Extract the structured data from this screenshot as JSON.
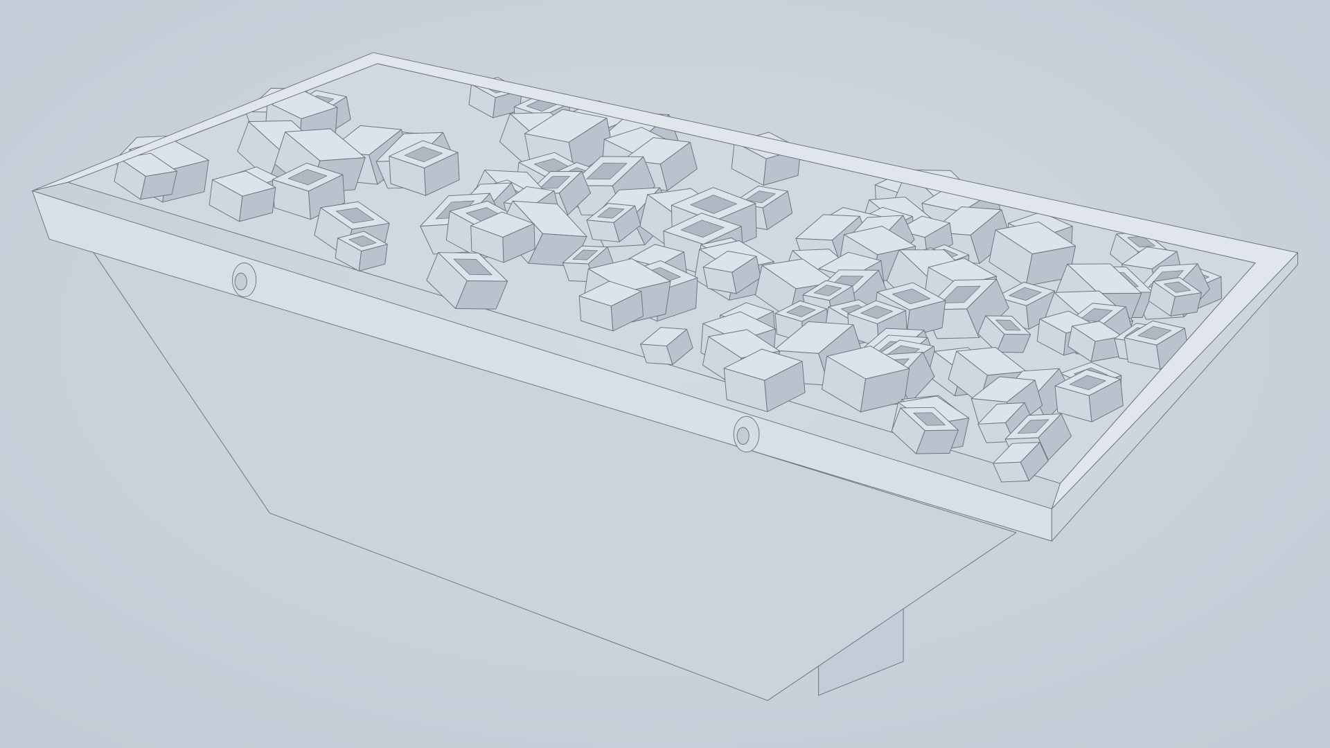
{
  "scene": {
    "subject": "skip",
    "colors": {
      "background": "#c9d2dc",
      "surface_light": "#dde3ea",
      "surface_mid": "#cfd7e0",
      "surface_dark": "#b9c3ce",
      "edge": "#6d747c"
    },
    "blocks": {
      "count": 120,
      "seed": 7
    }
  }
}
